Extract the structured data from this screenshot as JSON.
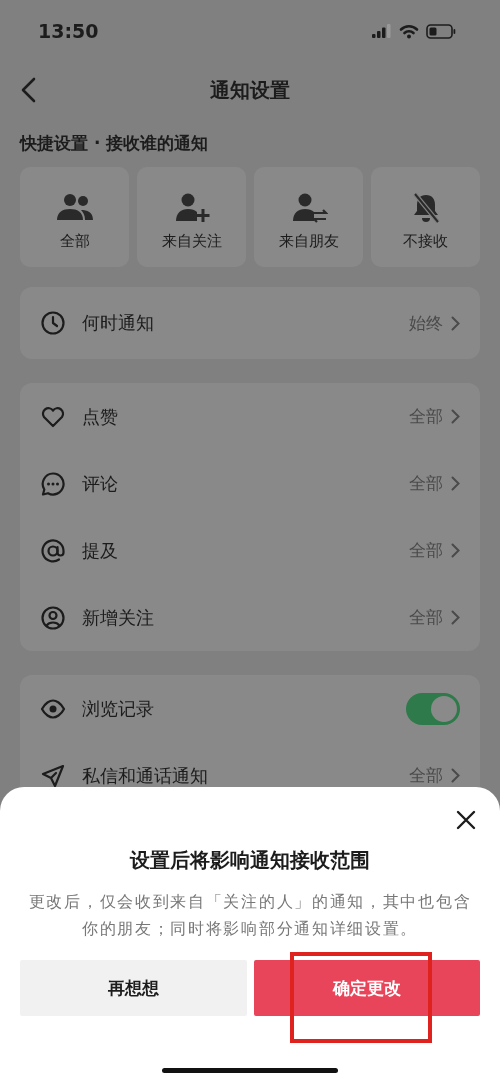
{
  "status_bar": {
    "time": "13:50"
  },
  "nav": {
    "title": "通知设置"
  },
  "quick_settings": {
    "label": "快捷设置 · 接收谁的通知",
    "options": [
      {
        "label": "全部"
      },
      {
        "label": "来自关注"
      },
      {
        "label": "来自朋友"
      },
      {
        "label": "不接收"
      }
    ]
  },
  "groups": [
    [
      {
        "kind": "link",
        "label": "何时通知",
        "value": "始终"
      }
    ],
    [
      {
        "kind": "link",
        "label": "点赞",
        "value": "全部"
      },
      {
        "kind": "link",
        "label": "评论",
        "value": "全部"
      },
      {
        "kind": "link",
        "label": "提及",
        "value": "全部"
      },
      {
        "kind": "link",
        "label": "新增关注",
        "value": "全部"
      }
    ],
    [
      {
        "kind": "toggle",
        "label": "浏览记录",
        "on": true
      },
      {
        "kind": "link",
        "label": "私信和通话通知",
        "value": "全部"
      }
    ]
  ],
  "sheet": {
    "title": "设置后将影响通知接收范围",
    "message": "更改后，仅会收到来自「关注的人」的通知，其中也包含你的朋友；同时将影响部分通知详细设置。",
    "buttons": [
      {
        "kind": "secondary",
        "label": "再想想"
      },
      {
        "kind": "primary",
        "label": "确定更改"
      }
    ]
  }
}
